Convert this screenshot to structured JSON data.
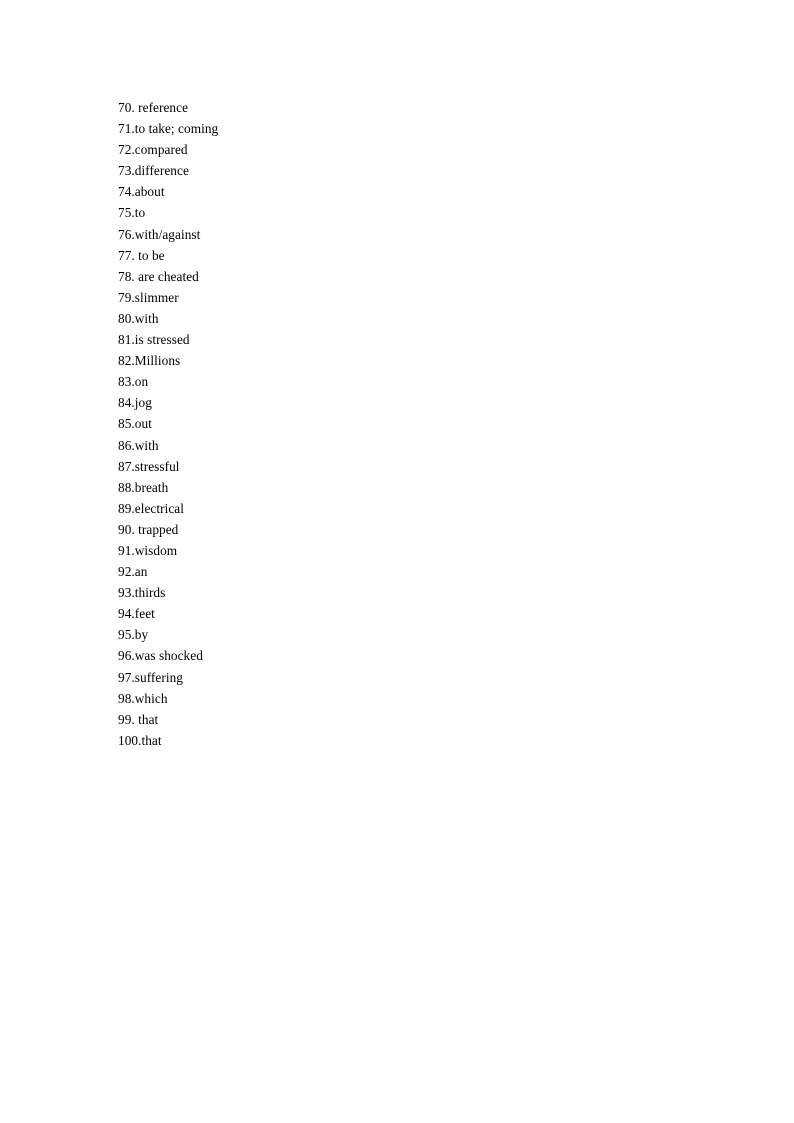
{
  "document": {
    "page_background": "#ffffff",
    "text_color": "#000000",
    "type": "answer-key-list"
  },
  "answers": [
    {
      "text": "70. reference"
    },
    {
      "text": "71.to take; coming"
    },
    {
      "text": "72.compared"
    },
    {
      "text": "73.difference"
    },
    {
      "text": "74.about"
    },
    {
      "text": "75.to"
    },
    {
      "text": "76.with/against"
    },
    {
      "text": "77. to be"
    },
    {
      "text": "78. are cheated"
    },
    {
      "text": "79.slimmer"
    },
    {
      "text": "80.with"
    },
    {
      "text": "81.is stressed"
    },
    {
      "text": "82.Millions"
    },
    {
      "text": "83.on"
    },
    {
      "text": "84.jog"
    },
    {
      "text": "85.out"
    },
    {
      "text": "86.with"
    },
    {
      "text": "87.stressful"
    },
    {
      "text": "88.breath"
    },
    {
      "text": "89.electrical"
    },
    {
      "text": "90. trapped"
    },
    {
      "text": "91.wisdom"
    },
    {
      "text": "92.an"
    },
    {
      "text": "93.thirds"
    },
    {
      "text": "94.feet"
    },
    {
      "text": "95.by"
    },
    {
      "text": "96.was shocked"
    },
    {
      "text": "97.suffering"
    },
    {
      "text": "98.which"
    },
    {
      "text": "99. that"
    },
    {
      "text": "100.that"
    }
  ]
}
